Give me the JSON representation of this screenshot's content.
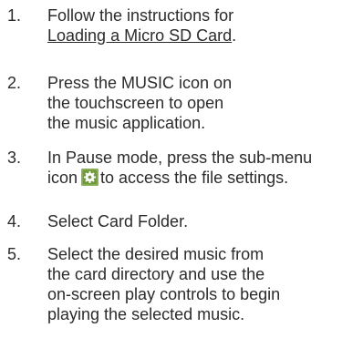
{
  "steps": [
    {
      "number": "1.",
      "lines": [
        "Follow the instructions for",
        "Loading a Micro SD Card",
        "."
      ]
    },
    {
      "number": "2.",
      "lines": [
        "Press the MUSIC icon on",
        "the touchscreen to open",
        "the music application."
      ]
    },
    {
      "number": "3.",
      "lines": [
        "In Pause mode, press the sub-menu",
        "icon",
        "to access the file settings."
      ],
      "icon": "gear-settings-icon"
    },
    {
      "number": "4.",
      "lines": [
        "Select Card Folder."
      ]
    },
    {
      "number": "5.",
      "lines": [
        "Select the desired music from",
        "the card directory and use the",
        "on-screen play controls to begin",
        "playing the selected music."
      ]
    }
  ],
  "colors": {
    "text": "#2b2b2b",
    "icon_bg": "#6f9a3a",
    "icon_fg": "#ffffff"
  }
}
